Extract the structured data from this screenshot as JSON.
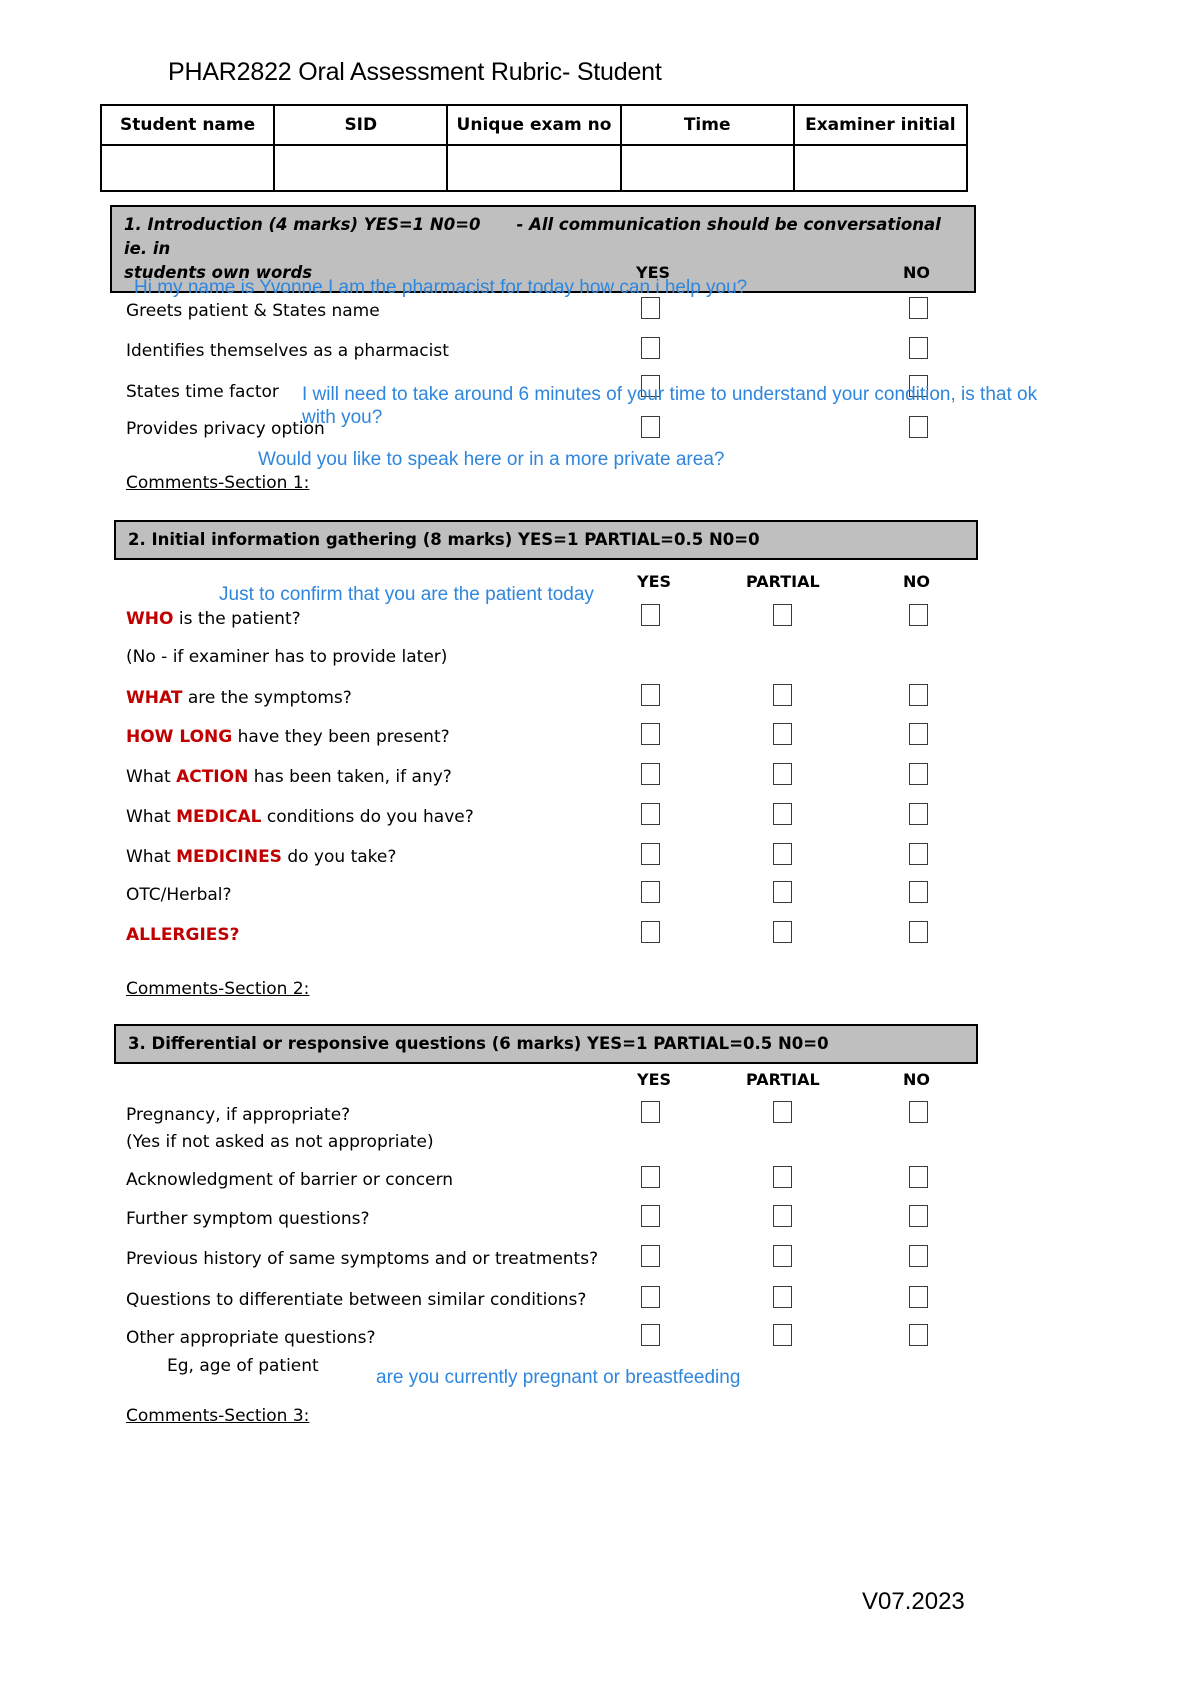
{
  "document": {
    "title": "PHAR2822 Oral Assessment Rubric- Student",
    "version": "V07.2023"
  },
  "identity_table": {
    "columns": [
      "Student name",
      "SID",
      "Unique exam no",
      "Time",
      "Examiner initial"
    ],
    "values": [
      "",
      "",
      "",
      "",
      ""
    ]
  },
  "sections": [
    {
      "id": "section-1",
      "heading_line1_prefix": "1. Introduction (4 marks) YES=1 N0=0",
      "heading_line1_suffix": "- All communication should be conversational ie. in",
      "heading_line2": "students own words",
      "column_headers": [
        "YES",
        "NO"
      ],
      "rows": [
        {
          "label": "Greets patient & States name"
        },
        {
          "label": "Identifies themselves as a pharmacist"
        },
        {
          "label": "States time factor"
        },
        {
          "label": "Provides privacy option"
        }
      ],
      "annotations": [
        "Hi my name is Yvonne I am the pharmacist for today how can i help you?",
        "I will need to take around 6 minutes of your time to understand your condition, is that ok",
        "with you?",
        "Would you like to speak here or in a more private area?"
      ],
      "comments_label": "Comments-Section 1:"
    },
    {
      "id": "section-2",
      "heading": "2. Initial information gathering (8 marks) YES=1 PARTIAL=0.5 N0=0",
      "column_headers": [
        "YES",
        "PARTIAL",
        "NO"
      ],
      "rows": [
        {
          "emphasis": "WHO",
          "rest": " is the patient?",
          "note": "(No - if examiner has to provide later)"
        },
        {
          "emphasis": "WHAT",
          "rest": " are the symptoms?"
        },
        {
          "emphasis": "HOW LONG",
          "rest": " have they been present?"
        },
        {
          "prefix": "What ",
          "emphasis": "ACTION",
          "rest": " has been taken, if any?"
        },
        {
          "prefix": "What ",
          "emphasis": "MEDICAL",
          "rest": " conditions do you have?"
        },
        {
          "prefix": "What ",
          "emphasis": "MEDICINES",
          "rest": " do you take?"
        },
        {
          "label": "OTC/Herbal?"
        },
        {
          "emphasis": "ALLERGIES?"
        }
      ],
      "annotations": [
        "Just to confirm that you are the patient today"
      ],
      "comments_label": "Comments-Section 2:"
    },
    {
      "id": "section-3",
      "heading": "3. Differential or responsive questions (6 marks) YES=1 PARTIAL=0.5 N0=0",
      "column_headers": [
        "YES",
        "PARTIAL",
        "NO"
      ],
      "rows": [
        {
          "label": "Pregnancy, if appropriate?",
          "note": "(Yes if not asked as not appropriate)"
        },
        {
          "label": "Acknowledgment of barrier or concern"
        },
        {
          "label": "Further symptom questions?"
        },
        {
          "label": "Previous history of same symptoms and or treatments?"
        },
        {
          "label": "Questions to differentiate between similar conditions?"
        },
        {
          "label": "Other appropriate questions?",
          "note": "Eg, age of patient"
        }
      ],
      "annotations": [
        "are you currently pregnant or breastfeeding"
      ],
      "comments_label": "Comments-Section 3:"
    }
  ],
  "colors": {
    "emphasis_red": "#c00000",
    "annotation_blue": "#2e86de",
    "section_bar_gray": "#bfbfbf"
  }
}
